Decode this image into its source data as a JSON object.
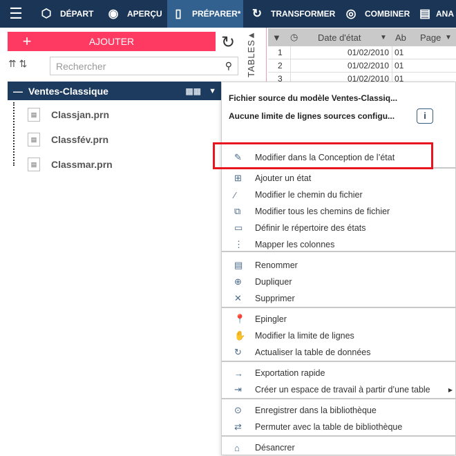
{
  "nav": {
    "tabs": [
      {
        "label": "DÉPART",
        "icon": "cube-icon"
      },
      {
        "label": "APERÇU",
        "icon": "eye-icon"
      },
      {
        "label": "PRÉPARER*",
        "icon": "prepare-icon",
        "active": true
      },
      {
        "label": "TRANSFORMER",
        "icon": "transform-icon"
      },
      {
        "label": "COMBINER",
        "icon": "combine-icon"
      },
      {
        "label": "ANA",
        "icon": "analyze-icon"
      }
    ]
  },
  "left": {
    "add_label": "AJOUTER",
    "search_placeholder": "Rechercher",
    "tables_label": "TABLES",
    "tree_title": "Ventes-Classique",
    "items": [
      "Classjan.prn",
      "Classfév.prn",
      "Classmar.prn"
    ]
  },
  "grid": {
    "headers": {
      "col1": "Date d'état",
      "col2": "Ab",
      "col3": "Page"
    },
    "rows": [
      {
        "n": "1",
        "d": "01/02/2010",
        "a": "01"
      },
      {
        "n": "2",
        "d": "01/02/2010",
        "a": "01"
      },
      {
        "n": "3",
        "d": "01/02/2010",
        "a": "01"
      }
    ]
  },
  "menu": {
    "header1": "Fichier source du modèle Ventes-Classiq...",
    "header2": "Aucune limite de lignes sources configu...",
    "info": "i",
    "items": [
      "Modifier dans la Conception de l’état",
      "Ajouter un état",
      "Modifier le chemin du fichier",
      "Modifier tous les chemins de fichier",
      "Définir le répertoire des états",
      "Mapper les colonnes",
      "Renommer",
      "Dupliquer",
      "Supprimer",
      "Epingler",
      "Modifier la limite de lignes",
      "Actualiser la table de données",
      "Exportation rapide",
      "Créer un espace de travail à partir d’une table",
      "Enregistrer dans la bibliothèque",
      "Permuter avec la table de bibliothèque",
      "Désancrer"
    ]
  }
}
